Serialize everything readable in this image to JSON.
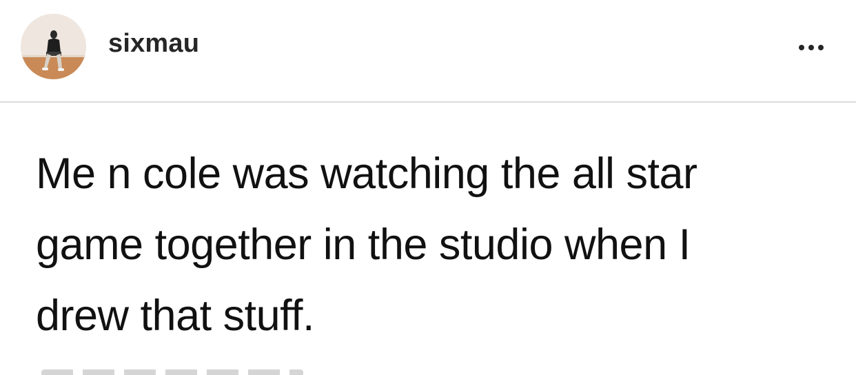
{
  "post": {
    "username": "sixmau",
    "more_icon": "more-horizontal-icon",
    "text": "Me n cole was watching the all star game together in the studio when I drew that stuff."
  },
  "colors": {
    "text": "#111111",
    "username": "#262626",
    "divider": "#dbdbdb",
    "background": "#ffffff"
  }
}
